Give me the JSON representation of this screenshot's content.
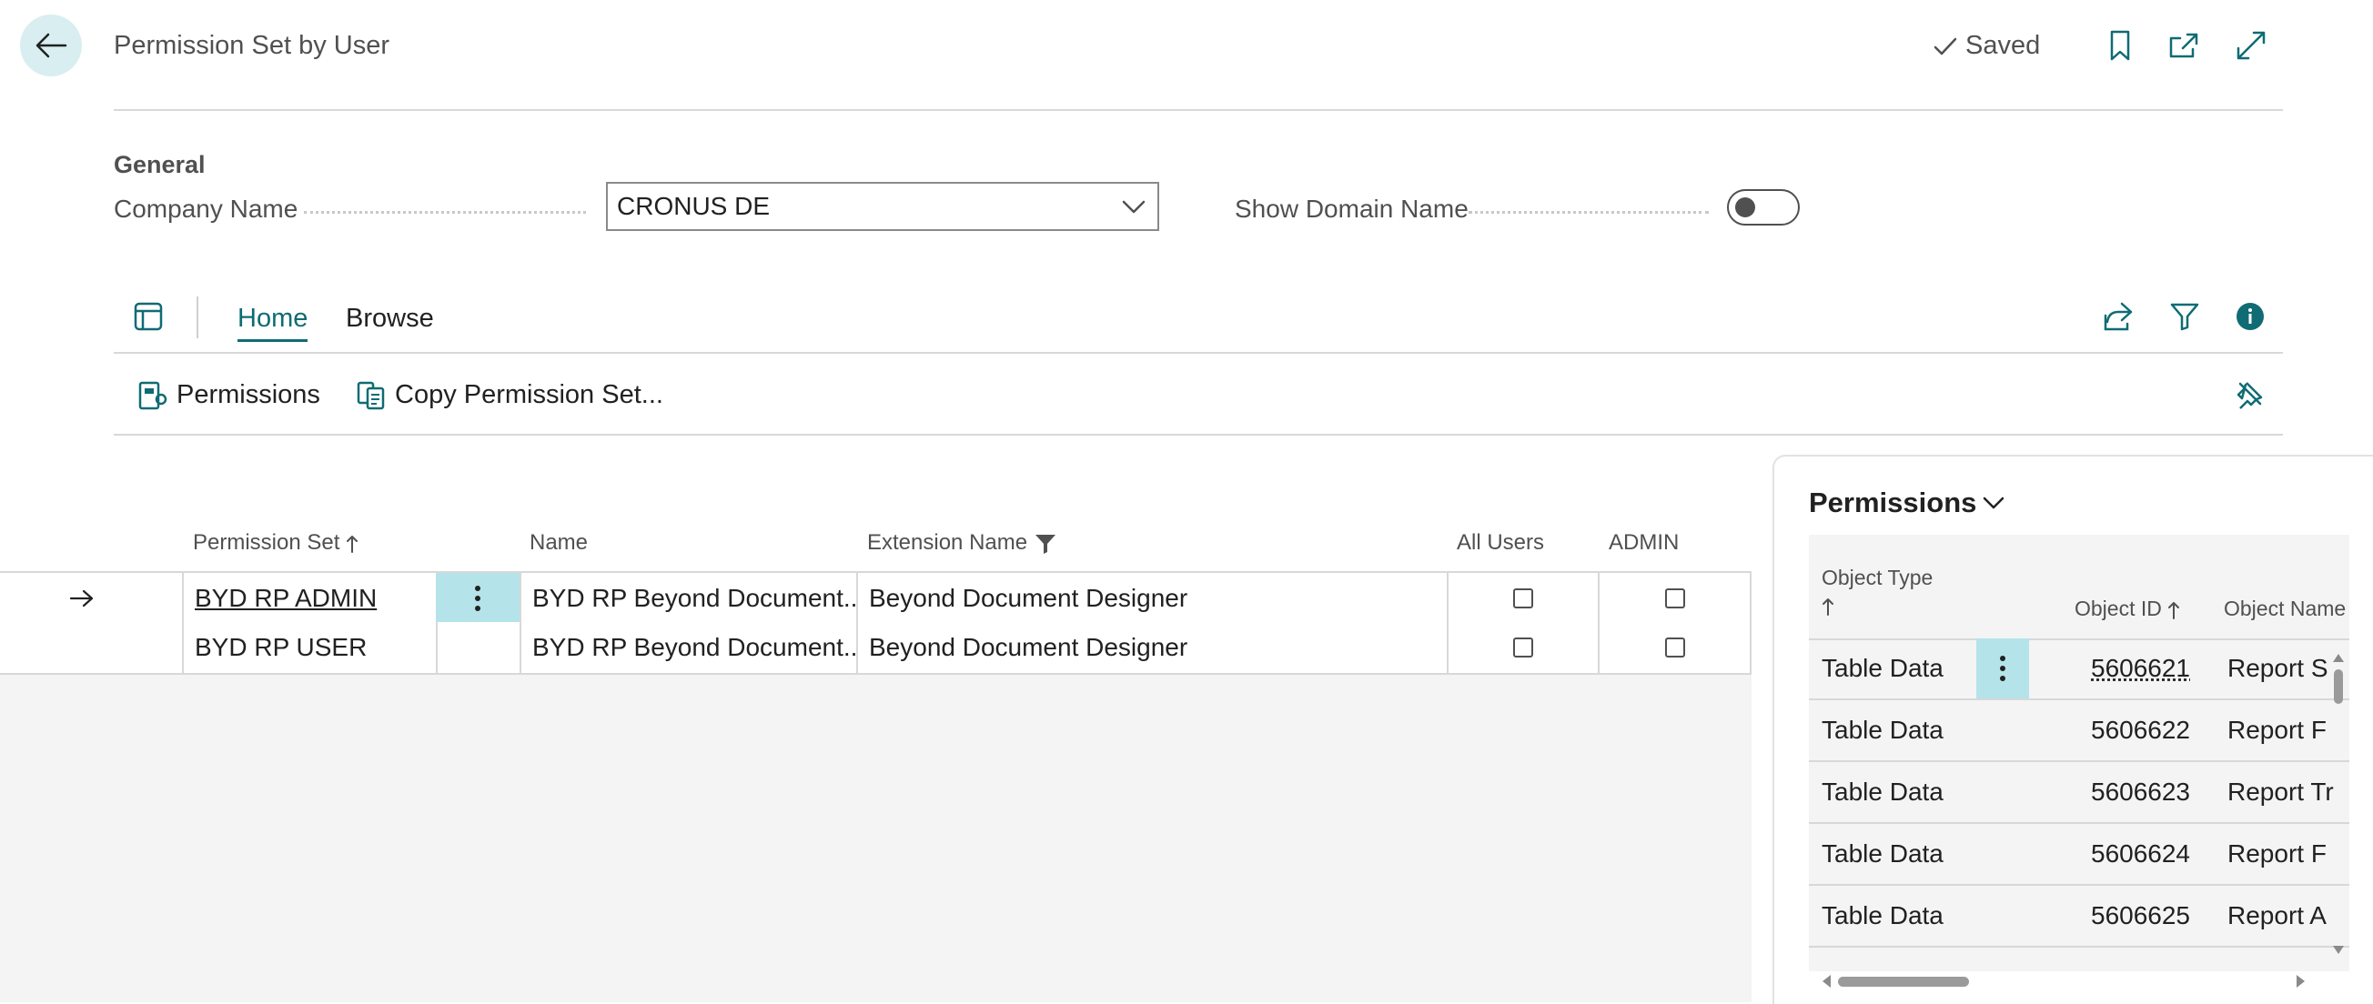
{
  "header": {
    "title": "Permission Set by User",
    "saved_label": "Saved"
  },
  "general": {
    "section_label": "General",
    "company_name_label": "Company Name",
    "company_name_value": "CRONUS DE",
    "show_domain_label": "Show Domain Name",
    "show_domain_value": false
  },
  "action_bar": {
    "tabs": [
      {
        "label": "Home",
        "active": true
      },
      {
        "label": "Browse",
        "active": false
      }
    ],
    "actions": [
      {
        "label": "Permissions"
      },
      {
        "label": "Copy Permission Set..."
      }
    ]
  },
  "list": {
    "columns": {
      "permission_set": "Permission Set",
      "name": "Name",
      "extension_name": "Extension Name",
      "all_users": "All Users",
      "admin": "ADMIN"
    },
    "rows": [
      {
        "permission_set": "BYD RP ADMIN",
        "name": "BYD RP Beyond Document...",
        "extension_name": "Beyond Document Designer",
        "all_users": false,
        "admin": false
      },
      {
        "permission_set": "BYD RP USER",
        "name": "BYD RP Beyond Document...",
        "extension_name": "Beyond Document Designer",
        "all_users": false,
        "admin": false
      }
    ]
  },
  "factbox": {
    "title": "Permissions",
    "columns": {
      "object_type": "Object Type",
      "object_id": "Object ID",
      "object_name": "Object Name"
    },
    "rows": [
      {
        "object_type": "Table Data",
        "object_id": "5606621",
        "object_name": "Report S"
      },
      {
        "object_type": "Table Data",
        "object_id": "5606622",
        "object_name": "Report F"
      },
      {
        "object_type": "Table Data",
        "object_id": "5606623",
        "object_name": "Report Tr"
      },
      {
        "object_type": "Table Data",
        "object_id": "5606624",
        "object_name": "Report F"
      },
      {
        "object_type": "Table Data",
        "object_id": "5606625",
        "object_name": "Report A"
      }
    ]
  },
  "colors": {
    "accent": "#0f6b74",
    "selected_cell": "#b4e4ea",
    "back_button_bg": "#d9eef0"
  }
}
